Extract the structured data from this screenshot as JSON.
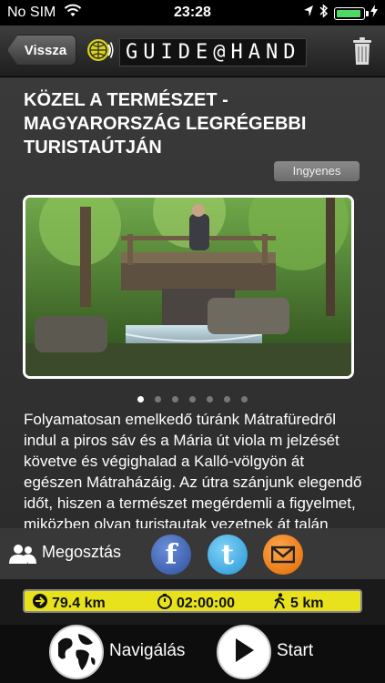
{
  "status": {
    "carrier": "No SIM",
    "time": "23:28",
    "battery_level": 0.95,
    "icons": [
      "wifi-icon",
      "location-arrow-icon",
      "bluetooth-icon",
      "battery-icon",
      "charging-bolt-icon"
    ]
  },
  "nav": {
    "back_label": "Vissza",
    "logo_text": "GUIDE@HAND",
    "icons": [
      "logo-speaker-icon",
      "trash-icon"
    ]
  },
  "tour": {
    "title": "KÖZEL A TERMÉSZET - MAGYARORSZÁG LEGRÉGEBBI TURISTAÚTJÁN",
    "price": "Ingyenes",
    "photo_count": 7,
    "active_photo": 1,
    "description": "Folyamatosan emelkedő túránk Mátrafüredről indul a piros sáv és a Mária út viola m jelzését követve és végighalad a Kalló-völgyön át egészen Mátraházáig. Az útra szánjunk elegendő időt, hiszen a természet megérdemli a figyelmet, miközben olyan turistautak vezetnek át talán magunkat annokkal gazdag tárakra hagas-Mátrao"
  },
  "share": {
    "label": "Megosztás",
    "icons": [
      "people-icon",
      "facebook-icon",
      "twitter-icon",
      "email-icon"
    ]
  },
  "stats": {
    "distance": "79.4 km",
    "duration": "02:00:00",
    "walk_distance": "5 km",
    "icons": [
      "arrow-right-circle-icon",
      "stopwatch-icon",
      "walker-icon"
    ],
    "bar_color": "#e7e21c"
  },
  "actions": {
    "navigate_label": "Navigálás",
    "start_label": "Start",
    "icons": [
      "globe-icon",
      "play-icon"
    ]
  }
}
